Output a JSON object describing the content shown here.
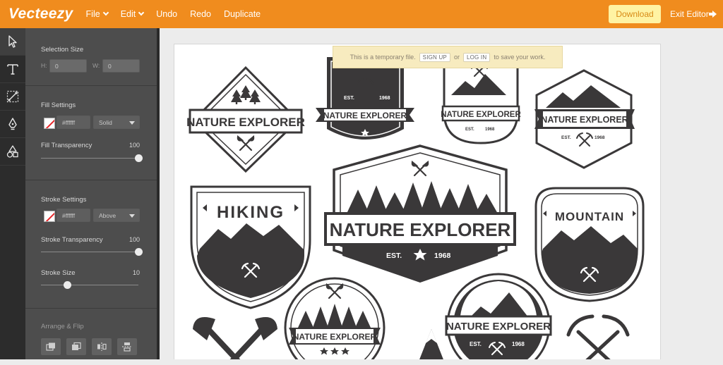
{
  "app": {
    "logo": "Vecteezy"
  },
  "menu": [
    {
      "label": "File",
      "dropdown": true
    },
    {
      "label": "Edit",
      "dropdown": true
    },
    {
      "label": "Undo",
      "dropdown": false
    },
    {
      "label": "Redo",
      "dropdown": false
    },
    {
      "label": "Duplicate",
      "dropdown": false
    }
  ],
  "header": {
    "download_label": "Download",
    "exit_label": "Exit Editor"
  },
  "tools": [
    "select-tool",
    "text-tool",
    "node-tool",
    "pen-tool",
    "shapes-tool"
  ],
  "panel": {
    "selection": {
      "title": "Selection Size",
      "h_label": "H:",
      "h_value": "0",
      "w_label": "W:",
      "w_value": "0"
    },
    "fill": {
      "title": "Fill Settings",
      "color": "#ffffff",
      "mode": "Solid",
      "transparency_label": "Fill Transparency",
      "transparency_value": "100",
      "transparency_fraction": 1.0
    },
    "stroke": {
      "title": "Stroke Settings",
      "color": "#ffffff",
      "mode": "Above",
      "transparency_label": "Stroke Transparency",
      "transparency_value": "100",
      "transparency_fraction": 1.0,
      "size_label": "Stroke Size",
      "size_value": "10",
      "size_fraction": 0.27
    },
    "arrange": {
      "title": "Arrange & Flip"
    }
  },
  "notice": {
    "prefix": "This is a temporary file.",
    "signup": "SIGN UP",
    "or": "or",
    "login": "LOG IN",
    "suffix": "to save your work."
  },
  "artwork": {
    "nature_explorer": "NATURE EXPLORER",
    "hiking": "HIKING",
    "mountain": "MOUNTAIN",
    "est": "EST.",
    "year": "1968"
  },
  "colors": {
    "brand": "#f08c1e",
    "download_bg": "#fff3a3",
    "panel": "#4d4d4d",
    "ink": "#3a3839"
  }
}
